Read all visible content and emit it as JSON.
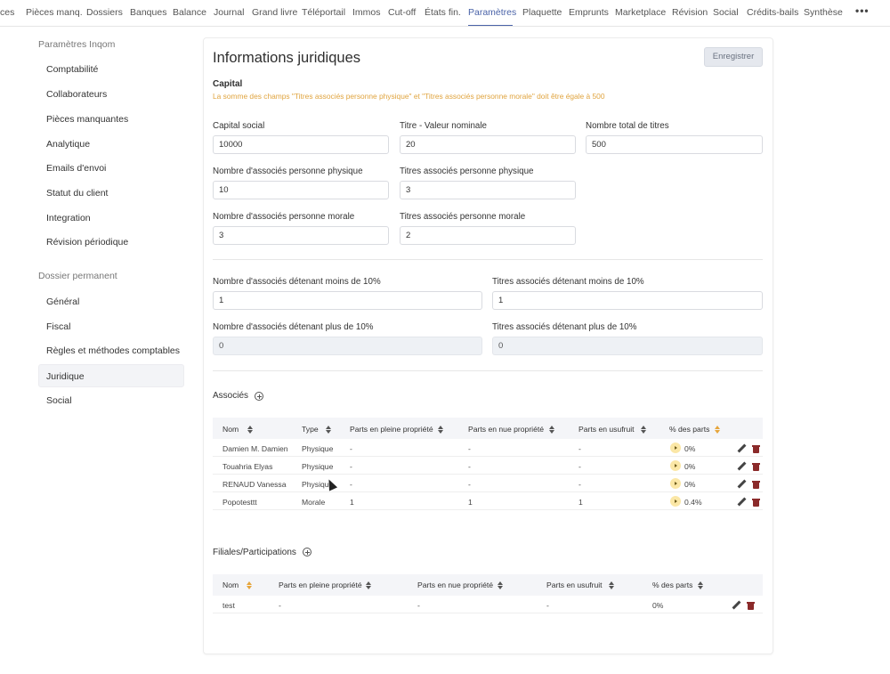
{
  "topnav": {
    "items": [
      "ces",
      "Pièces manq.",
      "Dossiers",
      "Banques",
      "Balance",
      "Journal",
      "Grand livre",
      "Téléportail",
      "Immos",
      "Cut-off",
      "États fin.",
      "Paramètres",
      "Plaquette",
      "Emprunts",
      "Marketplace",
      "Révision",
      "Social",
      "Crédits-bails",
      "Synthèse"
    ],
    "more": "•••",
    "active": "Paramètres"
  },
  "sidebar": {
    "section1": "Paramètres Inqom",
    "items1": [
      "Comptabilité",
      "Collaborateurs",
      "Pièces manquantes",
      "Analytique",
      "Emails d'envoi",
      "Statut du client",
      "Integration",
      "Révision périodique"
    ],
    "section2": "Dossier permanent",
    "items2": [
      "Général",
      "Fiscal",
      "Règles et méthodes comptables",
      "Juridique",
      "Social"
    ],
    "active": "Juridique"
  },
  "main": {
    "title": "Informations juridiques",
    "save_label": "Enregistrer",
    "capital_title": "Capital",
    "capital_warning": "La somme des champs \"Titres associés personne physique\" et \"Titres associés personne morale\" doit être égale à 500",
    "fields": {
      "capital_social": {
        "label": "Capital social",
        "value": "10000"
      },
      "titre_valeur": {
        "label": "Titre - Valeur nominale",
        "value": "20"
      },
      "nombre_total_titres": {
        "label": "Nombre total de titres",
        "value": "500"
      },
      "nb_associes_physique": {
        "label": "Nombre d'associés personne physique",
        "value": "10"
      },
      "titres_physique": {
        "label": "Titres associés personne physique",
        "value": "3"
      },
      "nb_associes_morale": {
        "label": "Nombre d'associés personne morale",
        "value": "3"
      },
      "titres_morale": {
        "label": "Titres associés personne morale",
        "value": "2"
      },
      "nb_moins_10": {
        "label": "Nombre d'associés détenant moins de 10%",
        "value": "1"
      },
      "titres_moins_10": {
        "label": "Titres associés détenant moins de 10%",
        "value": "1"
      },
      "nb_plus_10": {
        "label": "Nombre d'associés détenant plus de 10%",
        "value": "0"
      },
      "titres_plus_10": {
        "label": "Titres associés détenant plus de 10%",
        "value": "0"
      }
    },
    "associes": {
      "title": "Associés",
      "headers": [
        "Nom",
        "Type",
        "Parts en pleine propriété",
        "Parts en nue propriété",
        "Parts en usufruit",
        "% des parts"
      ],
      "rows": [
        {
          "nom": "Damien M. Damien",
          "type": "Physique",
          "pleine": "-",
          "nue": "-",
          "usufruit": "-",
          "pct": "0%"
        },
        {
          "nom": "Touahria Elyas",
          "type": "Physique",
          "pleine": "-",
          "nue": "-",
          "usufruit": "-",
          "pct": "0%"
        },
        {
          "nom": "RENAUD Vanessa",
          "type": "Physique",
          "pleine": "-",
          "nue": "-",
          "usufruit": "-",
          "pct": "0%"
        },
        {
          "nom": "Popotesttt",
          "type": "Morale",
          "pleine": "1",
          "nue": "1",
          "usufruit": "1",
          "pct": "0.4%"
        }
      ]
    },
    "filiales": {
      "title": "Filiales/Participations",
      "headers": [
        "Nom",
        "Parts en pleine propriété",
        "Parts en nue propriété",
        "Parts en usufruit",
        "% des parts"
      ],
      "rows": [
        {
          "nom": "test",
          "pleine": "-",
          "nue": "-",
          "usufruit": "-",
          "pct": "0%"
        }
      ]
    }
  },
  "colors": {
    "accent": "#4a63a8",
    "warning": "#e0a43f",
    "delete": "#8b2a2a"
  }
}
